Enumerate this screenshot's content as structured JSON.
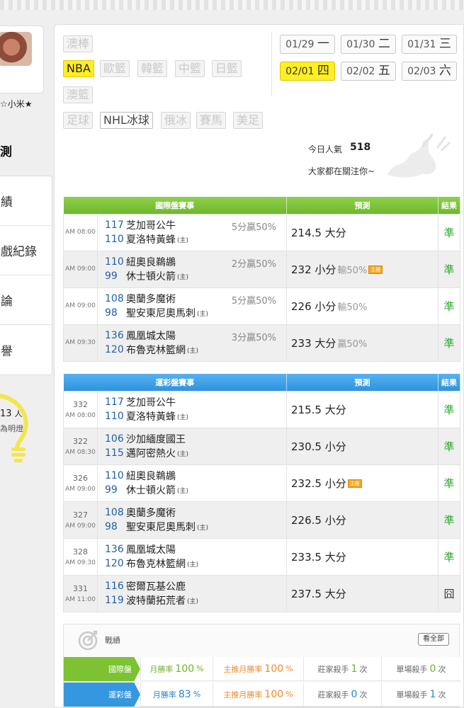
{
  "sidebar": {
    "username": "☆小米★",
    "predict_tab": "測",
    "menu": [
      "績",
      "戲紀錄",
      "論",
      "譽"
    ],
    "bulb_count": "13",
    "bulb_unit": "人",
    "bulb_desc": "為明燈"
  },
  "leagues": [
    {
      "label": "澳棒",
      "state": "disabled"
    },
    {
      "label": "NBA",
      "state": "active"
    },
    {
      "label": "歐籃",
      "state": "disabled"
    },
    {
      "label": "韓籃",
      "state": "disabled"
    },
    {
      "label": "中籃",
      "state": "disabled"
    },
    {
      "label": "日籃",
      "state": "disabled"
    },
    {
      "label": "澳籃",
      "state": "disabled"
    },
    {
      "label": "足球",
      "state": "disabled"
    },
    {
      "label": "NHL冰球",
      "state": "enabled"
    },
    {
      "label": "俄冰",
      "state": "disabled"
    },
    {
      "label": "賽馬",
      "state": "disabled"
    },
    {
      "label": "美足",
      "state": "disabled"
    }
  ],
  "dates": [
    {
      "date": "01/29",
      "day": "一",
      "active": false
    },
    {
      "date": "01/30",
      "day": "二",
      "active": false
    },
    {
      "date": "01/31",
      "day": "三",
      "active": false
    },
    {
      "date": "02/01",
      "day": "四",
      "active": true
    },
    {
      "date": "02/02",
      "day": "五",
      "active": false
    },
    {
      "date": "02/03",
      "day": "六",
      "active": false
    }
  ],
  "popularity": {
    "label": "今日人氣",
    "value": "518",
    "sub": "大家都在關注你~"
  },
  "intl_table": {
    "headers": [
      "國際盤賽事",
      "預測",
      "結果"
    ],
    "rows": [
      {
        "time": "AM 08:00",
        "away_num": "117",
        "away": "芝加哥公牛",
        "home_num": "110",
        "home": "夏洛特黃蜂",
        "spread": "5分贏50%",
        "pred": "214.5 大分",
        "pred_extra": "",
        "tag": false,
        "result": "準"
      },
      {
        "time": "AM 09:00",
        "away_num": "110",
        "away": "紐奧良鵜鶘",
        "home_num": "99",
        "home": "休士頓火箭",
        "spread": "2分贏50%",
        "pred": "232 小分",
        "pred_extra": "輸50%",
        "tag": true,
        "result": "準"
      },
      {
        "time": "AM 09:00",
        "away_num": "108",
        "away": "奧蘭多魔術",
        "home_num": "98",
        "home": "聖安東尼奧馬刺",
        "spread": "5分贏50%",
        "pred": "226 小分",
        "pred_extra": "輸50%",
        "tag": false,
        "result": "準"
      },
      {
        "time": "AM 09:30",
        "away_num": "136",
        "away": "鳳凰城太陽",
        "home_num": "120",
        "home": "布魯克林籃網",
        "spread": "3分贏50%",
        "pred": "233 大分",
        "pred_extra": "贏50%",
        "tag": false,
        "result": "準"
      }
    ]
  },
  "lottery_table": {
    "headers": [
      "運彩盤賽事",
      "預測",
      "結果"
    ],
    "rows": [
      {
        "code": "332",
        "time": "AM 08:00",
        "away_num": "117",
        "away": "芝加哥公牛",
        "home_num": "110",
        "home": "夏洛特黃蜂",
        "pred": "215.5 大分",
        "tag": false,
        "result": "準",
        "miss": false
      },
      {
        "code": "322",
        "time": "AM 08:30",
        "away_num": "106",
        "away": "沙加緬度國王",
        "home_num": "115",
        "home": "邁阿密熱火",
        "pred": "230.5 小分",
        "tag": false,
        "result": "準",
        "miss": false
      },
      {
        "code": "326",
        "time": "AM 09:00",
        "away_num": "110",
        "away": "紐奧良鵜鶘",
        "home_num": "99",
        "home": "休士頓火箭",
        "pred": "232.5 小分",
        "tag": true,
        "result": "準",
        "miss": false
      },
      {
        "code": "327",
        "time": "AM 09:00",
        "away_num": "108",
        "away": "奧蘭多魔術",
        "home_num": "98",
        "home": "聖安東尼奧馬刺",
        "pred": "226.5 小分",
        "tag": false,
        "result": "準",
        "miss": false
      },
      {
        "code": "328",
        "time": "AM 09:30",
        "away_num": "136",
        "away": "鳳凰城太陽",
        "home_num": "120",
        "home": "布魯克林籃網",
        "pred": "233.5 大分",
        "tag": false,
        "result": "準",
        "miss": false
      },
      {
        "code": "331",
        "time": "AM 11:00",
        "away_num": "116",
        "away": "密爾瓦基公鹿",
        "home_num": "119",
        "home": "波特蘭拓荒者",
        "pred": "237.5 大分",
        "tag": false,
        "result": "囧",
        "miss": true
      }
    ]
  },
  "home_mark": "(主)",
  "tag_label": "主推",
  "stats": {
    "title": "戰績",
    "view_all": "看全部",
    "rows": [
      {
        "label": "國際盤",
        "win_label": "月勝率",
        "win": "100",
        "main_label": "主推月勝率",
        "main": "100",
        "banker_label": "莊家殺手",
        "banker": "1",
        "single_label": "單場殺手",
        "single": "0",
        "unit_pct": "%",
        "unit_times": "次"
      },
      {
        "label": "運彩盤",
        "win_label": "月勝率",
        "win": "83",
        "main_label": "主推月勝率",
        "main": "100",
        "banker_label": "莊家殺手",
        "banker": "0",
        "single_label": "單場殺手",
        "single": "1",
        "unit_pct": "%",
        "unit_times": "次"
      }
    ]
  }
}
